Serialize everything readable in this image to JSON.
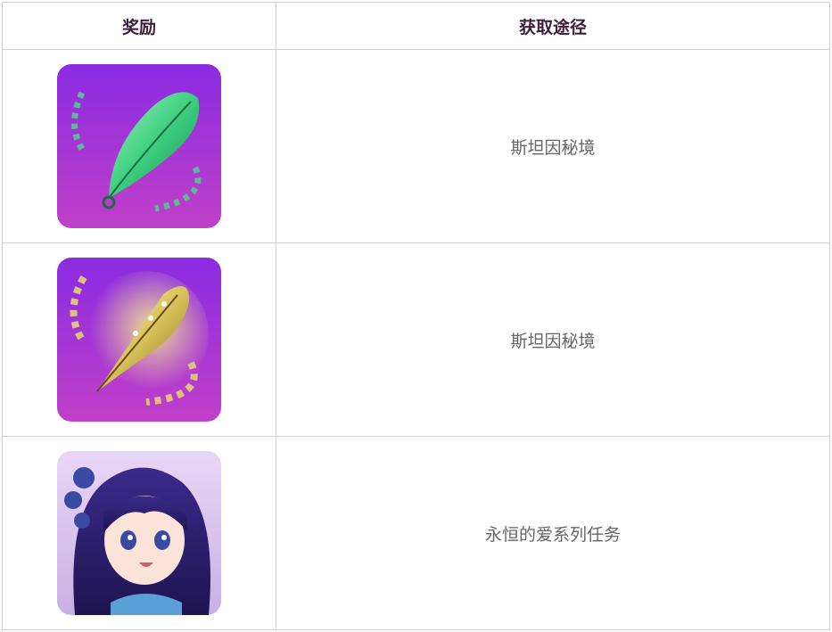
{
  "table": {
    "headers": [
      "奖励",
      "获取途径"
    ],
    "rows": [
      {
        "icon": "green-feather-icon",
        "source": "斯坦因秘境"
      },
      {
        "icon": "golden-feather-icon",
        "source": "斯坦因秘境"
      },
      {
        "icon": "character-portrait-icon",
        "source": "永恒的爱系列任务"
      }
    ]
  },
  "colors": {
    "header_text": "#3d1f3d",
    "cell_text": "#666666",
    "border": "#d0d0d0",
    "icon_bg_top": "#8a2be2",
    "icon_bg_bottom": "#c040c8"
  }
}
